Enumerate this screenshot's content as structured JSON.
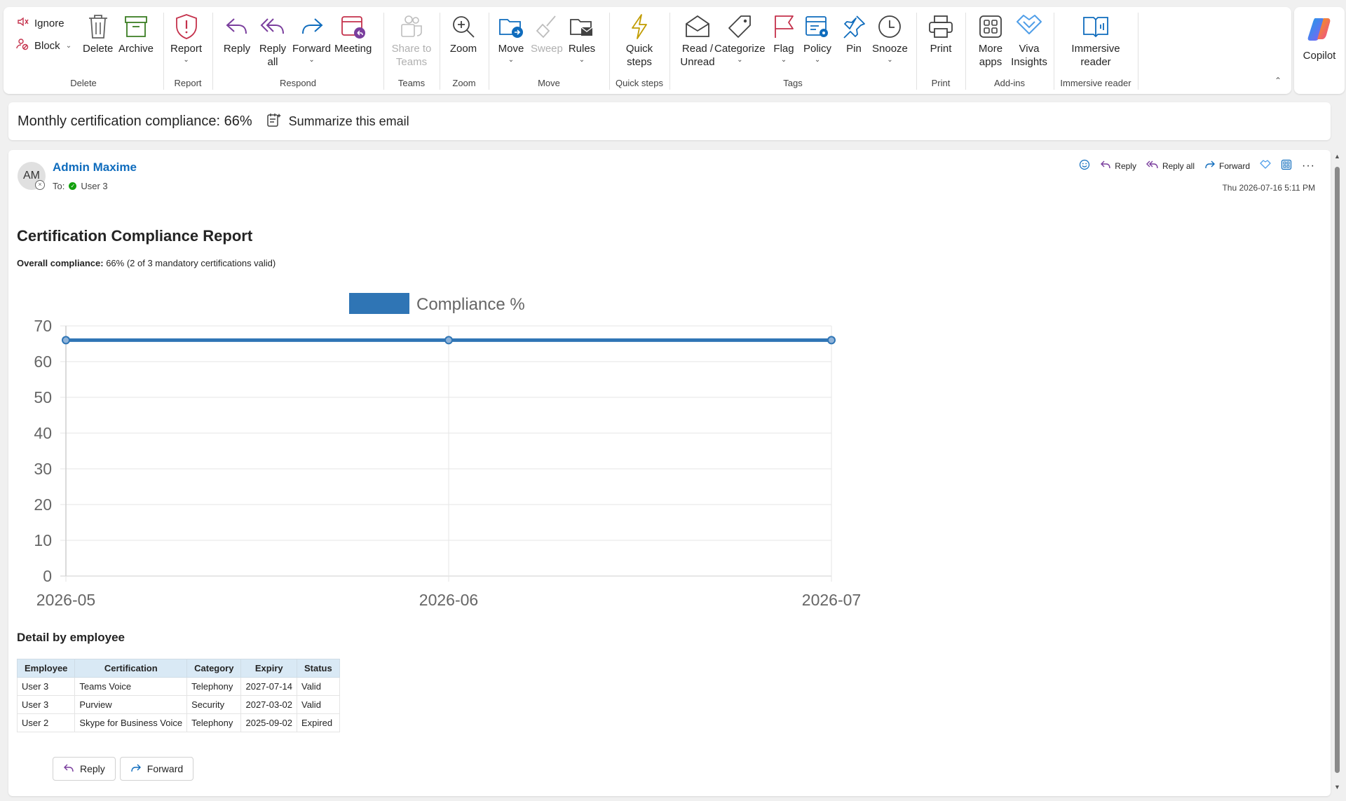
{
  "ribbon": {
    "ignore": "Ignore",
    "block": "Block",
    "delete": "Delete",
    "archive": "Archive",
    "report": "Report",
    "reply": "Reply",
    "reply_all": "Reply all",
    "forward": "Forward",
    "meeting": "Meeting",
    "share_teams": "Share to Teams",
    "zoom": "Zoom",
    "move": "Move",
    "sweep": "Sweep",
    "rules": "Rules",
    "quick_steps": "Quick steps",
    "read_unread": "Read / Unread",
    "categorize": "Categorize",
    "flag": "Flag",
    "policy": "Policy",
    "pin": "Pin",
    "snooze": "Snooze",
    "print": "Print",
    "more_apps": "More apps",
    "viva_insights": "Viva Insights",
    "immersive_reader": "Immersive reader",
    "groups": {
      "delete": "Delete",
      "report": "Report",
      "respond": "Respond",
      "teams": "Teams",
      "zoom": "Zoom",
      "move": "Move",
      "quick_steps": "Quick steps",
      "tags": "Tags",
      "print": "Print",
      "addins": "Add-ins",
      "immersive": "Immersive reader"
    },
    "copilot": "Copilot"
  },
  "subject_bar": {
    "subject": "Monthly certification compliance: 66%",
    "summarize": "Summarize this email"
  },
  "message": {
    "avatar_initials": "AM",
    "sender": "Admin Maxime",
    "to_label": "To:",
    "recipient": "User 3",
    "timestamp": "Thu 2026-07-16 5:11 PM",
    "actions": {
      "reply": "Reply",
      "reply_all": "Reply all",
      "forward": "Forward"
    },
    "title": "Certification Compliance Report",
    "overall_label": "Overall compliance:",
    "overall_value": "66% (2 of 3 mandatory certifications valid)",
    "detail_title": "Detail by employee",
    "table": {
      "headers": [
        "Employee",
        "Certification",
        "Category",
        "Expiry",
        "Status"
      ],
      "rows": [
        [
          "User 3",
          "Teams Voice",
          "Telephony",
          "2027-07-14",
          "Valid"
        ],
        [
          "User 3",
          "Purview",
          "Security",
          "2027-03-02",
          "Valid"
        ],
        [
          "User 2",
          "Skype for Business Voice",
          "Telephony",
          "2025-09-02",
          "Expired"
        ]
      ]
    },
    "bottom_reply": "Reply",
    "bottom_forward": "Forward"
  },
  "colors": {
    "accent": "#0f6cbd",
    "series": "#2f75b5",
    "header_bg": "#d9e9f5"
  },
  "chart_data": {
    "type": "line",
    "x": [
      "2026-05",
      "2026-06",
      "2026-07"
    ],
    "series": [
      {
        "name": "Compliance %",
        "values": [
          66,
          66,
          66
        ]
      }
    ],
    "ylim": [
      0,
      70
    ],
    "yticks": [
      0,
      10,
      20,
      30,
      40,
      50,
      60,
      70
    ],
    "grid": true,
    "legend": "top-center"
  }
}
